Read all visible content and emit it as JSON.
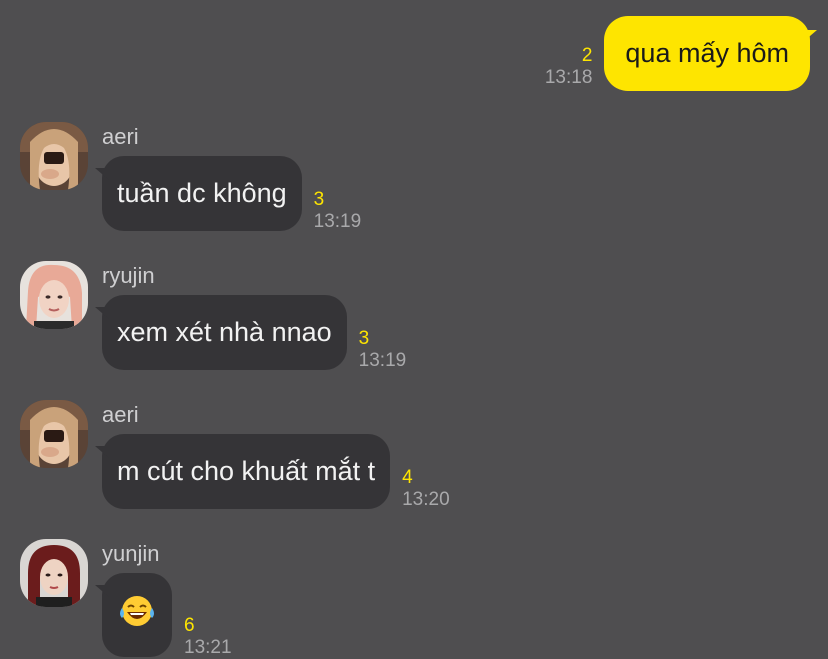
{
  "outgoing": {
    "text": "qua mấy hôm",
    "unread": "2",
    "time": "13:18"
  },
  "messages": [
    {
      "sender": "aeri",
      "avatar_icon": "aeri-avatar",
      "text": "tuần dc không",
      "unread": "3",
      "time": "13:19"
    },
    {
      "sender": "ryujin",
      "avatar_icon": "ryujin-avatar",
      "text": "xem xét nhà nnao",
      "unread": "3",
      "time": "13:19"
    },
    {
      "sender": "aeri",
      "avatar_icon": "aeri-avatar",
      "text": "m cút cho khuất mắt t",
      "unread": "4",
      "time": "13:20"
    },
    {
      "sender": "yunjin",
      "avatar_icon": "laughing-tears-emoji",
      "text": "",
      "unread": "6",
      "time": "13:21"
    }
  ],
  "colors": {
    "background": "#4f4e50",
    "outgoing_bubble": "#fee500",
    "incoming_bubble": "#353437",
    "unread_count": "#fee500"
  }
}
